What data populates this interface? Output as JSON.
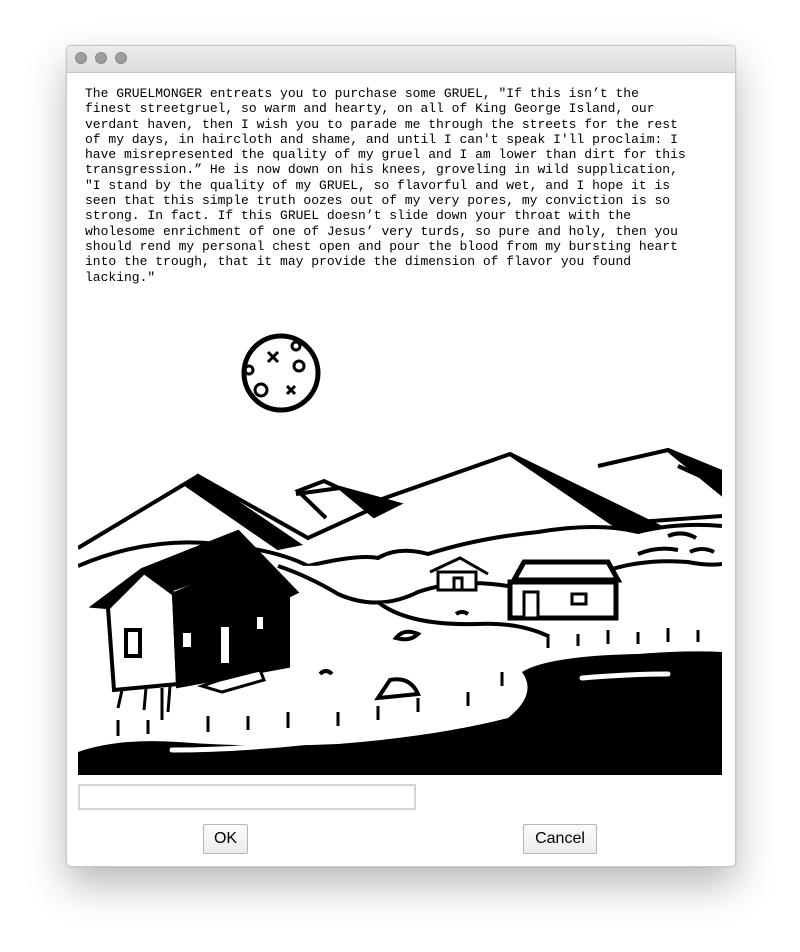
{
  "dialog": {
    "message_lines": [
      "The GRUELMONGER entreats you to purchase some GRUEL, \"If this isn’t the",
      "finest streetgruel, so warm and hearty, on all of King George Island, our",
      "verdant haven, then I wish you to parade me through the streets for the rest",
      "of my days, in haircloth and shame, and until I can't speak I'll proclaim: I",
      "have misrepresented the quality of my gruel and I am lower than dirt for this",
      "transgression.” He is now down on his knees, groveling in wild supplication,",
      "\"I stand by the quality of my GRUEL, so flavorful and wet, and I hope it is",
      "seen that this simple truth oozes out of my very pores, my conviction is so",
      "strong. In fact. If this GRUEL doesn’t slide down your throat with the",
      "wholesome enrichment of one of Jesus’ very turds, so pure and holy, then you",
      "should rend my personal chest open and pour the blood from my bursting heart",
      "into the trough, that it may provide the dimension of flavor you found",
      "lacking.\""
    ],
    "input_value": "",
    "input_placeholder": "",
    "ok_label": "OK",
    "cancel_label": "Cancel"
  },
  "colors": {
    "ink": "#000000",
    "paper": "#ffffff",
    "titlebar": "#e3e3e3",
    "traffic_light": "#9e9e9e"
  }
}
